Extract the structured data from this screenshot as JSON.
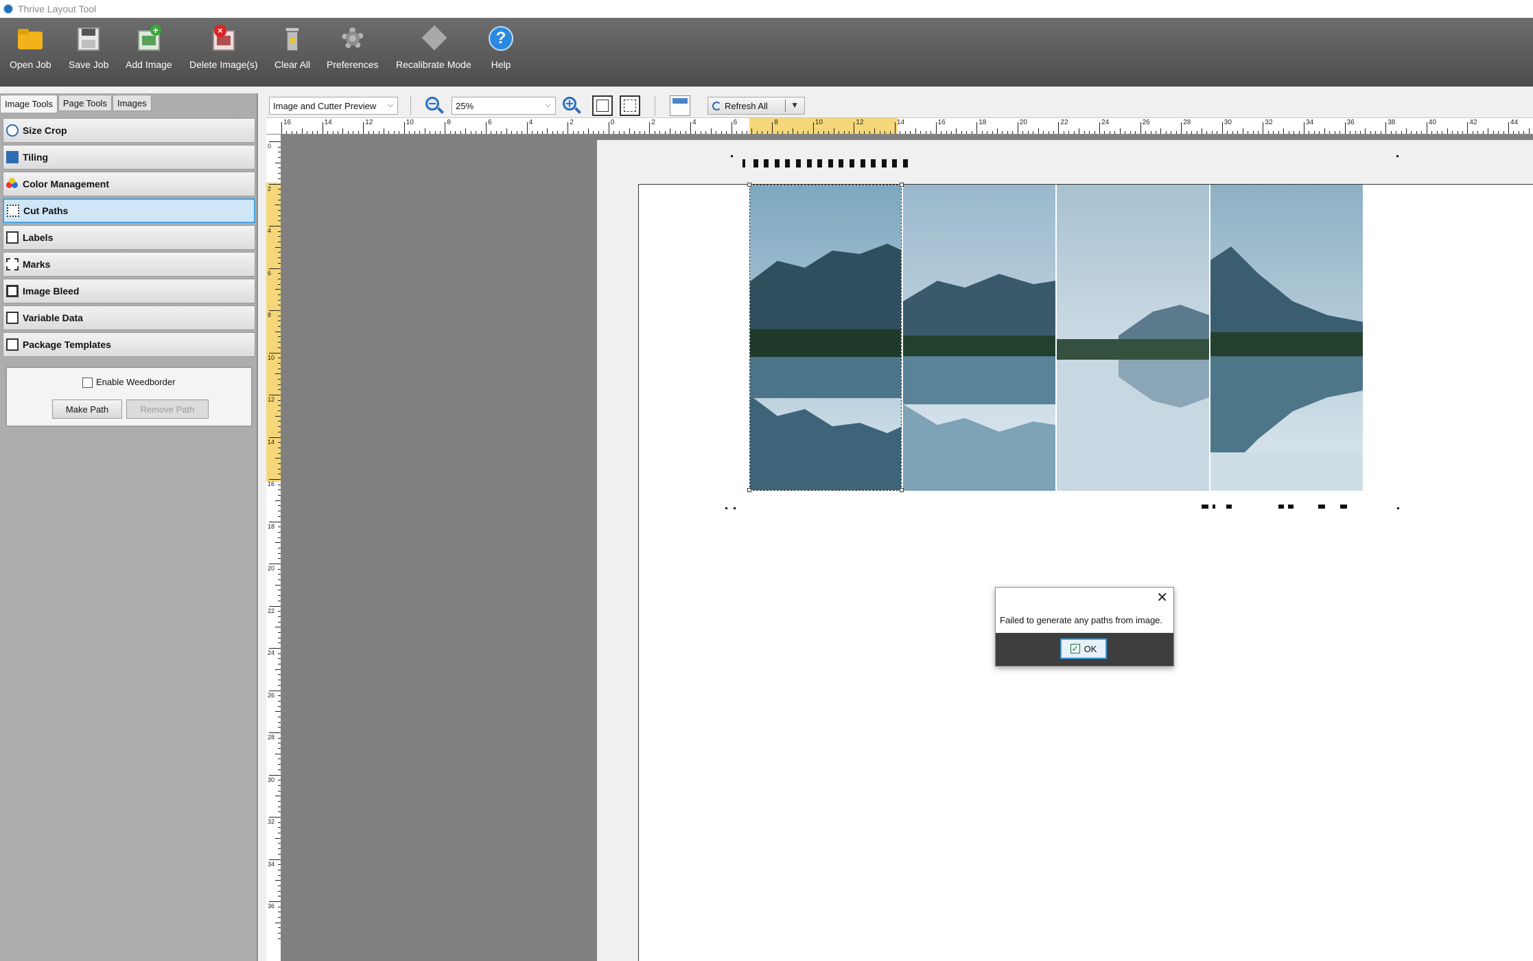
{
  "window": {
    "title": "Thrive Layout Tool"
  },
  "toolbar": {
    "open_job": "Open Job",
    "save_job": "Save Job",
    "add_image": "Add Image",
    "delete_images": "Delete Image(s)",
    "clear_all": "Clear All",
    "preferences": "Preferences",
    "recalibrate_mode": "Recalibrate Mode",
    "help": "Help"
  },
  "left_tabs": [
    "Image Tools",
    "Page Tools",
    "Images"
  ],
  "tools": [
    "Size Crop",
    "Tiling",
    "Color Management",
    "Cut Paths",
    "Labels",
    "Marks",
    "Image Bleed",
    "Variable Data",
    "Package Templates"
  ],
  "cut_paths": {
    "enable_weedborder": "Enable Weedborder",
    "weedborder_checked": false,
    "make_path": "Make Path",
    "remove_path": "Remove Path"
  },
  "view": {
    "mode": "Image and Cutter Preview",
    "zoom": "25%",
    "refresh_all": "Refresh All"
  },
  "ruler": {
    "h_labels": [
      "16",
      "14",
      "12",
      "10",
      "8",
      "6",
      "4",
      "2",
      "0",
      "2",
      "4",
      "6",
      "8",
      "10",
      "12",
      "14",
      "16",
      "18",
      "20",
      "22",
      "24",
      "26",
      "28",
      "30",
      "32",
      "34",
      "36",
      "38",
      "40",
      "42",
      "44"
    ],
    "v_labels": [
      "0",
      "2",
      "4",
      "6",
      "8",
      "10",
      "12",
      "14",
      "16",
      "18",
      "20",
      "22",
      "24",
      "26",
      "28",
      "30",
      "32",
      "34",
      "36"
    ]
  },
  "dialog": {
    "message": "Failed to generate any paths from image.",
    "ok_label": "OK"
  },
  "colors": {
    "toolbar_bg": "#5e5e5e",
    "selected_tool": "#cfe6f7",
    "ruler_highlight": "#f5d77a",
    "canvas_bg": "#808080"
  }
}
